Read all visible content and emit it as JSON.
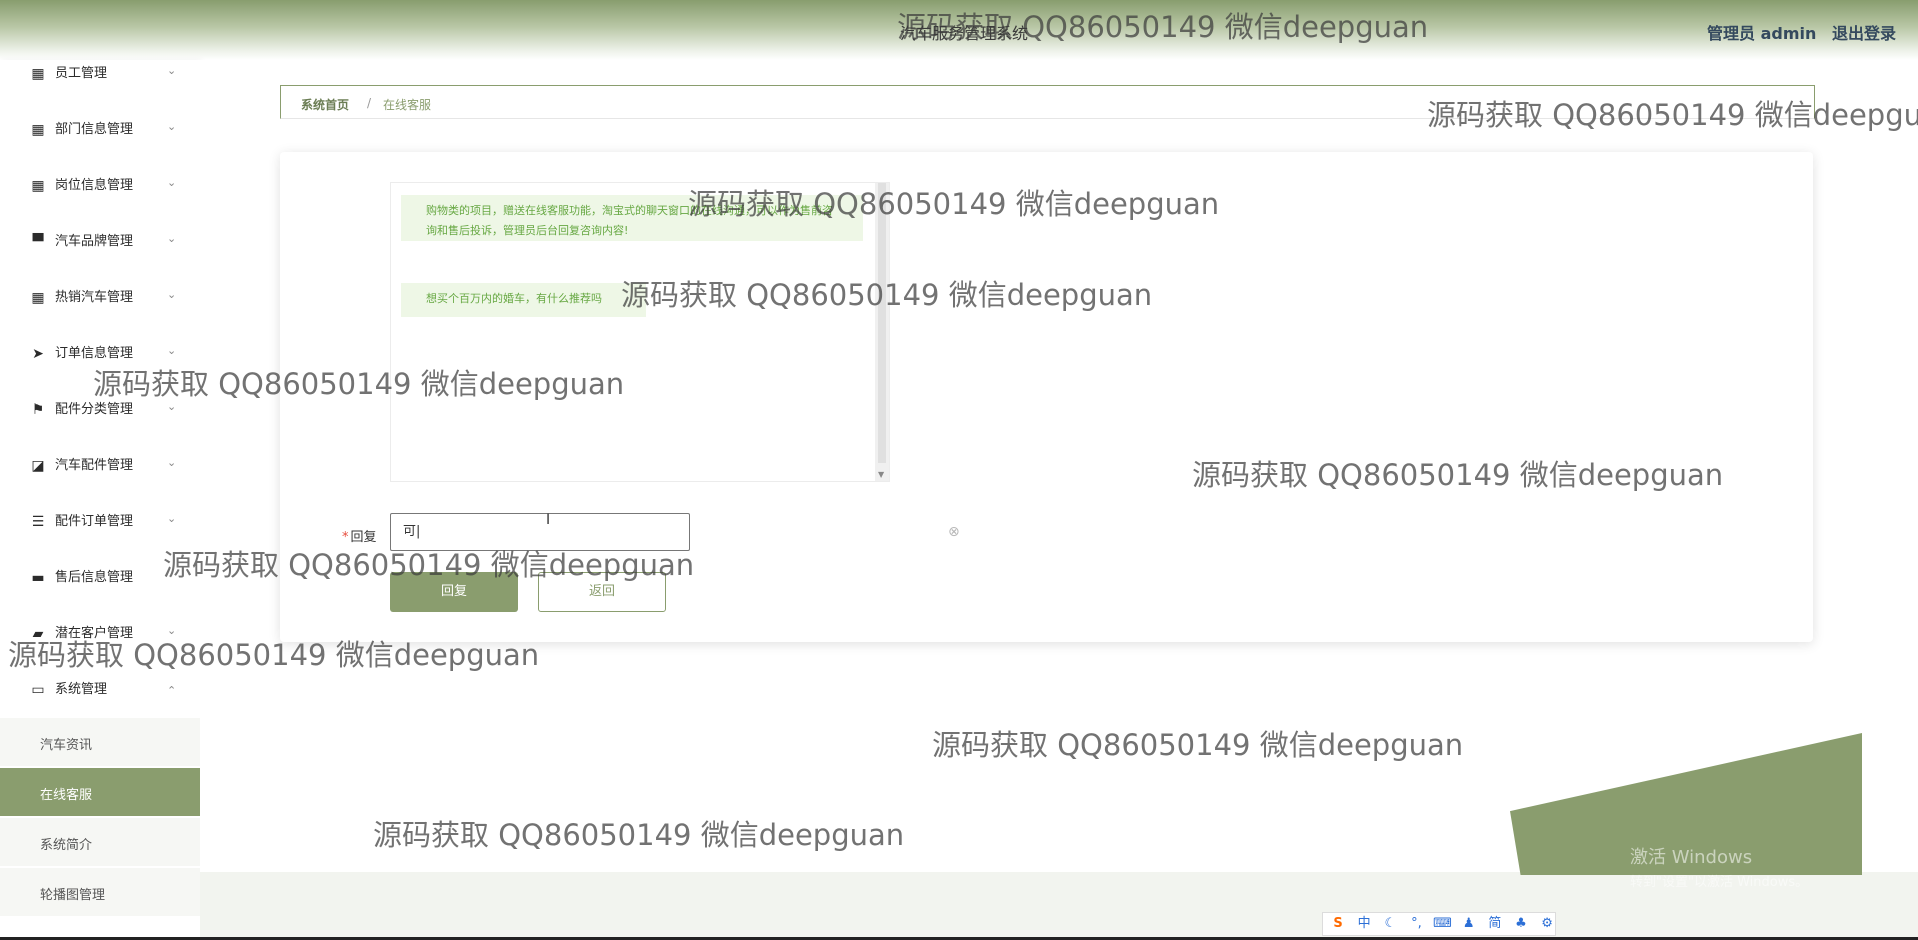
{
  "header": {
    "app_title": "汽车服务管理系统",
    "user_label": "管理员 admin",
    "logout_label": "退出登录"
  },
  "sidebar": {
    "items": [
      {
        "label": "员工管理",
        "icon": "grid-icon"
      },
      {
        "label": "部门信息管理",
        "icon": "grid-icon"
      },
      {
        "label": "岗位信息管理",
        "icon": "grid-icon"
      },
      {
        "label": "汽车品牌管理",
        "icon": "brush-icon"
      },
      {
        "label": "热销汽车管理",
        "icon": "grid-icon"
      },
      {
        "label": "订单信息管理",
        "icon": "send-icon"
      },
      {
        "label": "配件分类管理",
        "icon": "flag-icon"
      },
      {
        "label": "汽车配件管理",
        "icon": "chart-icon"
      },
      {
        "label": "配件订单管理",
        "icon": "list-icon"
      },
      {
        "label": "售后信息管理",
        "icon": "message-icon"
      },
      {
        "label": "潜在客户管理",
        "icon": "ticket-icon"
      },
      {
        "label": "系统管理",
        "icon": "monitor-icon",
        "expanded": true
      }
    ],
    "sub_items": [
      {
        "label": "汽车资讯"
      },
      {
        "label": "在线客服",
        "active": true
      },
      {
        "label": "系统简介"
      },
      {
        "label": "轮播图管理"
      }
    ]
  },
  "breadcrumb": {
    "home": "系统首页",
    "separator": "/",
    "current": "在线客服"
  },
  "chat": {
    "messages": [
      "购物类的项目，赠送在线客服功能，淘宝式的聊天窗口的在线沟通，可以作为售前咨询和售后投诉，管理员后台回复咨询内容!",
      "想买个百万内的婚车，有什么推荐吗"
    ]
  },
  "form": {
    "reply_label": "回复",
    "required_mark": "*",
    "reply_value": "可|",
    "submit_label": "回复",
    "back_label": "返回"
  },
  "watermark": {
    "text": "源码获取 QQ86050149 微信deepguan"
  },
  "system": {
    "activate_title": "激活 Windows",
    "activate_sub": "转到\"设置\"以激活 Windows。",
    "ime": [
      "中",
      "简"
    ]
  },
  "colors": {
    "accent": "#8a9d6e",
    "message_bg": "#eef7e6",
    "message_text": "#67a843",
    "required": "#e74c3c"
  }
}
